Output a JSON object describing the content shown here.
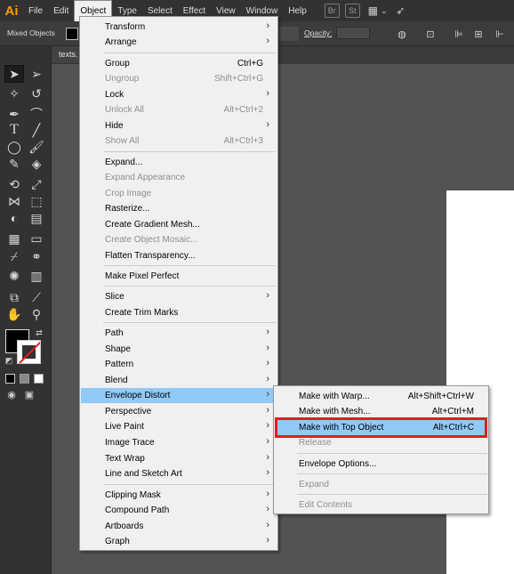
{
  "app": {
    "logo": "Ai"
  },
  "menubar": {
    "items": [
      "File",
      "Edit",
      "Object",
      "Type",
      "Select",
      "Effect",
      "View",
      "Window",
      "Help"
    ],
    "active": "Object",
    "right_icons": [
      "Br",
      "St"
    ]
  },
  "controlbar": {
    "selection_label": "Mixed Objects",
    "opacity_label": "Opacity:"
  },
  "document": {
    "tab_label": "texts."
  },
  "object_menu": [
    {
      "label": "Transform",
      "submenu": true
    },
    {
      "label": "Arrange",
      "submenu": true
    },
    {
      "label": "Group",
      "shortcut": "Ctrl+G"
    },
    {
      "label": "Ungroup",
      "shortcut": "Shift+Ctrl+G",
      "disabled": true
    },
    {
      "label": "Lock",
      "submenu": true
    },
    {
      "label": "Unlock All",
      "shortcut": "Alt+Ctrl+2",
      "disabled": true
    },
    {
      "label": "Hide",
      "submenu": true
    },
    {
      "label": "Show All",
      "shortcut": "Alt+Ctrl+3",
      "disabled": true
    },
    {
      "label": "Expand..."
    },
    {
      "label": "Expand Appearance",
      "disabled": true
    },
    {
      "label": "Crop Image",
      "disabled": true
    },
    {
      "label": "Rasterize..."
    },
    {
      "label": "Create Gradient Mesh..."
    },
    {
      "label": "Create Object Mosaic...",
      "disabled": true
    },
    {
      "label": "Flatten Transparency..."
    },
    {
      "label": "Make Pixel Perfect"
    },
    {
      "label": "Slice",
      "submenu": true
    },
    {
      "label": "Create Trim Marks"
    },
    {
      "label": "Path",
      "submenu": true
    },
    {
      "label": "Shape",
      "submenu": true
    },
    {
      "label": "Pattern",
      "submenu": true
    },
    {
      "label": "Blend",
      "submenu": true
    },
    {
      "label": "Envelope Distort",
      "submenu": true,
      "highlighted": true
    },
    {
      "label": "Perspective",
      "submenu": true
    },
    {
      "label": "Live Paint",
      "submenu": true
    },
    {
      "label": "Image Trace",
      "submenu": true
    },
    {
      "label": "Text Wrap",
      "submenu": true
    },
    {
      "label": "Line and Sketch Art",
      "submenu": true
    },
    {
      "label": "Clipping Mask",
      "submenu": true
    },
    {
      "label": "Compound Path",
      "submenu": true
    },
    {
      "label": "Artboards",
      "submenu": true
    },
    {
      "label": "Graph",
      "submenu": true
    }
  ],
  "envelope_menu": [
    {
      "label": "Make with Warp...",
      "shortcut": "Alt+Shift+Ctrl+W"
    },
    {
      "label": "Make with Mesh...",
      "shortcut": "Alt+Ctrl+M"
    },
    {
      "label": "Make with Top Object",
      "shortcut": "Alt+Ctrl+C",
      "highlighted": true
    },
    {
      "label": "Release",
      "disabled": true
    },
    {
      "label": "Envelope Options..."
    },
    {
      "label": "Expand",
      "disabled": true
    },
    {
      "label": "Edit Contents",
      "disabled": true
    }
  ],
  "colors": {
    "highlight": "#91c9f7",
    "annotation": "#e01e1e",
    "logo": "#ff9a00"
  }
}
